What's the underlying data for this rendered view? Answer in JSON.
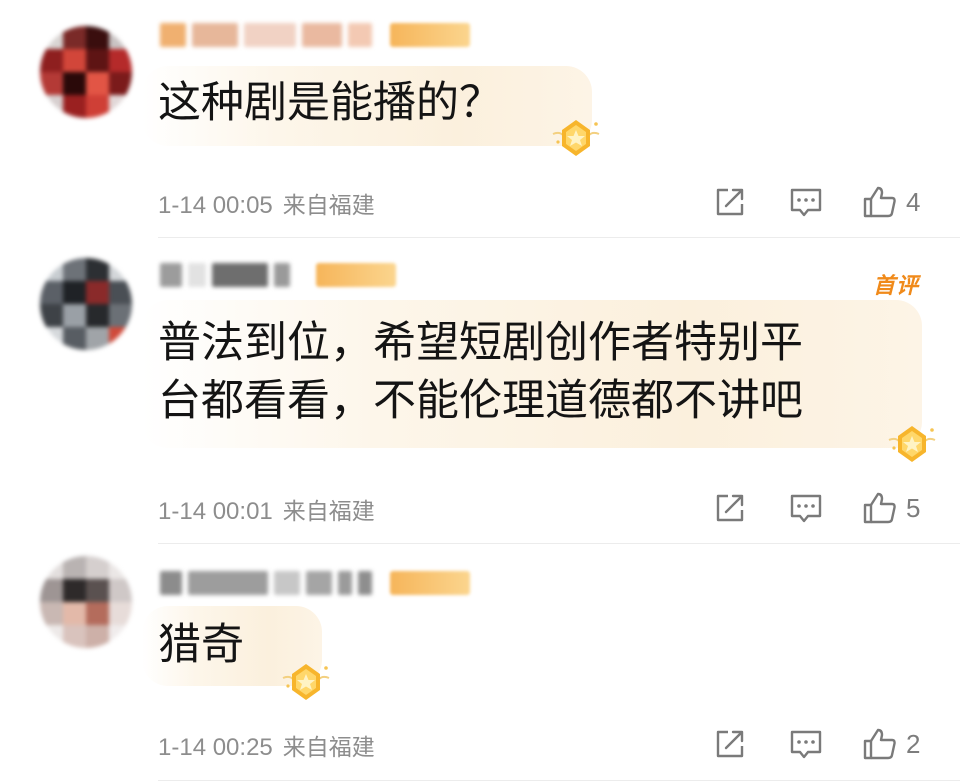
{
  "comments": [
    {
      "text": "这种剧是能播的？",
      "time": "1-14 00:05",
      "location": "来自福建",
      "likes": "4",
      "first_comment_badge": ""
    },
    {
      "text": "普法到位，希望短剧创作者特别平\n台都看看，不能伦理道德都不讲吧",
      "time": "1-14 00:01",
      "location": "来自福建",
      "likes": "5",
      "first_comment_badge": "首评"
    },
    {
      "text": "猎奇",
      "time": "1-14 00:25",
      "location": "来自福建",
      "likes": "2",
      "first_comment_badge": ""
    }
  ],
  "icons": {
    "share": "share-icon",
    "reply": "reply-icon",
    "like": "thumbs-up-icon",
    "medal": "medal-icon"
  },
  "colors": {
    "meta_text": "#8d8d8d",
    "badge_orange": "#f08a1a",
    "bubble_tint": "#fbf0dd"
  }
}
